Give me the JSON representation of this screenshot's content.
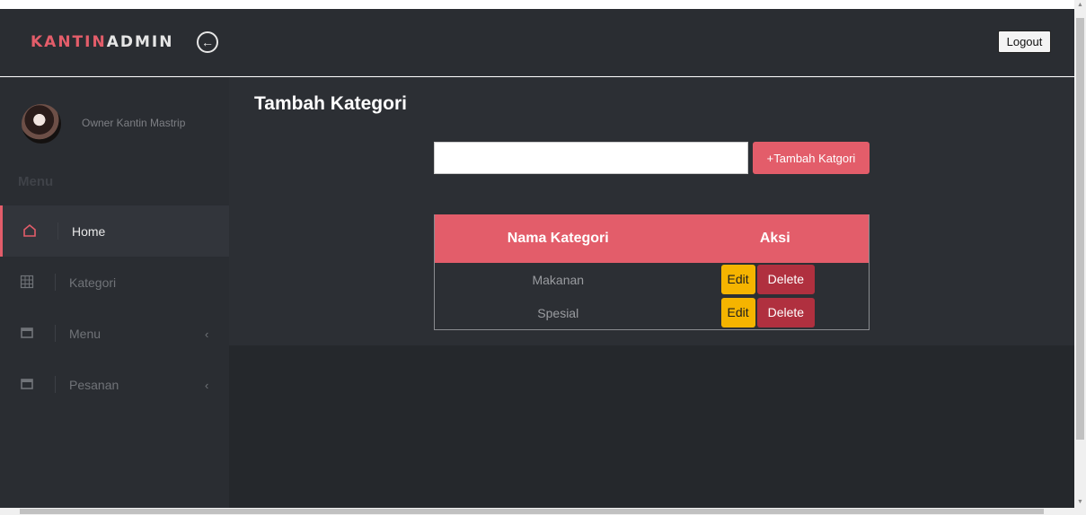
{
  "header": {
    "logo_part1": "KANTIN",
    "logo_part2": "ADMIN",
    "toggle_icon": "←",
    "logout_label": "Logout"
  },
  "sidebar": {
    "user_name": "Owner Kantin Mastrip",
    "menu_heading": "Menu",
    "items": [
      {
        "label": "Home",
        "icon": "home-icon"
      },
      {
        "label": "Kategori",
        "icon": "grid-icon"
      },
      {
        "label": "Menu",
        "icon": "window-icon",
        "chevron": "‹"
      },
      {
        "label": "Pesanan",
        "icon": "window-icon",
        "chevron": "‹"
      }
    ]
  },
  "main": {
    "title": "Tambah Kategori",
    "input_value": "",
    "add_button_label": "+Tambah Katgori",
    "table": {
      "headers": [
        "Nama Kategori",
        "Aksi"
      ],
      "rows": [
        {
          "name": "Makanan",
          "edit": "Edit",
          "delete": "Delete"
        },
        {
          "name": "Spesial",
          "edit": "Edit",
          "delete": "Delete"
        }
      ]
    }
  },
  "colors": {
    "accent": "#e35d6a",
    "dark_bg": "#2a2d32",
    "edit": "#f5b400",
    "delete": "#b0303f"
  }
}
